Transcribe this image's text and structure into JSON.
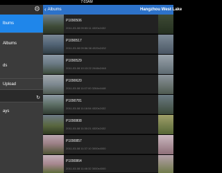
{
  "status_bar": {
    "time": "7:03AM"
  },
  "sidebar": {
    "items": [
      {
        "label": "lbums"
      },
      {
        "label": "Albums"
      },
      {
        "label": "ds"
      },
      {
        "label": "Upload"
      },
      {
        "label": "ays"
      }
    ]
  },
  "header": {
    "back_label": "Albums",
    "title": "Hangzhou West Lake"
  },
  "photos": [
    {
      "name": "P1090506",
      "meta": "2011-03-08 09:53:11   4320x2432"
    },
    {
      "name": "P1090517",
      "meta": "2011-03-08 09:56:38   4320x2432"
    },
    {
      "name": "P1090529",
      "meta": "2011-03-08 10:13:22   2448x2448"
    },
    {
      "name": "P1090620",
      "meta": "2011-03-08 11:07:00   3264x4448"
    },
    {
      "name": "P1090781",
      "meta": "2011-03-08 11:18:54   4320x2432"
    },
    {
      "name": "P1090808",
      "meta": "2011-03-08 11:30:21   4320x2432"
    },
    {
      "name": "P1090857",
      "meta": "2011-03-08 11:37:10   3000x4000"
    },
    {
      "name": "P1090864",
      "meta": "2011-03-08 11:46:32   3000x4000"
    }
  ]
}
